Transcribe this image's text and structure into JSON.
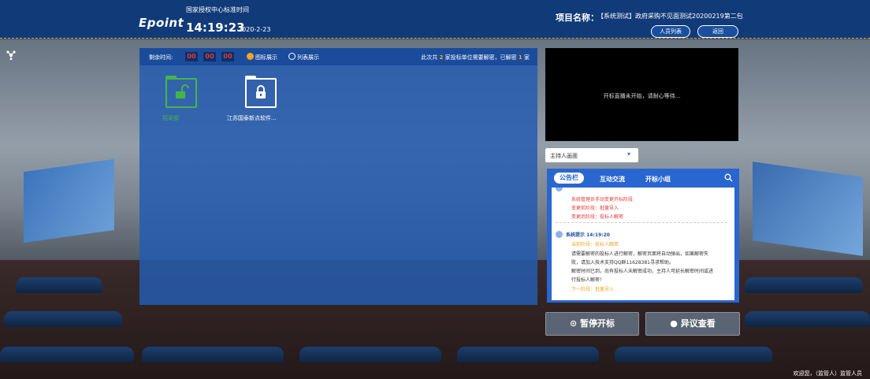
{
  "header": {
    "logo": "Epoint",
    "time_label": "国家授权中心标准时间",
    "time": "14:19:23",
    "date": "2020-2-23",
    "project_label": "项目名称：",
    "project_value": "【系统测试】政府采购不见面测试20200219第二包",
    "btn_people": "人员列表",
    "btn_back": "返回"
  },
  "left_panel": {
    "remain_label": "剩余时间:",
    "remain_values": [
      "00",
      "00",
      "00"
    ],
    "mode_icon": "图标展示",
    "mode_list": "列表展示",
    "summary_prefix": "此次共",
    "summary_total": "2",
    "summary_mid": "家投标单位需要解密，已解密",
    "summary_done": "1",
    "summary_suffix": "家",
    "folders": [
      {
        "label": "招采部",
        "state": "unlocked"
      },
      {
        "label": "江苏国泰新点软件...",
        "state": "locked"
      }
    ]
  },
  "video": {
    "message": "开标直播未开始，请耐心等待..."
  },
  "select": {
    "value": "主持人画面"
  },
  "chat": {
    "tabs": [
      "公告栏",
      "互动交流",
      "开标小组"
    ],
    "messages": [
      {
        "lines": [
          "系统管理员手动变更开标阶段",
          "变更前阶段：批量导入",
          "变更后阶段：投标人解密"
        ]
      },
      {
        "header": "系统提示 14:19:20",
        "stage": "当前阶段：投标人解密",
        "lines": [
          "请需要解密的投标人进行解密，解密页面将自动弹出，如果解密失",
          "败，请加入技术支持QQ群11628381寻求帮助。",
          "解密时间已到，尚有投标人未解密成功，主持人可延长解密时间或进",
          "行投标人解密！"
        ],
        "next": "下一阶段：批量导入"
      }
    ]
  },
  "buttons": {
    "pause": "暂停开标",
    "objection": "异议查看"
  },
  "footer": {
    "welcome": "欢迎您，（监管人）监管人员"
  }
}
